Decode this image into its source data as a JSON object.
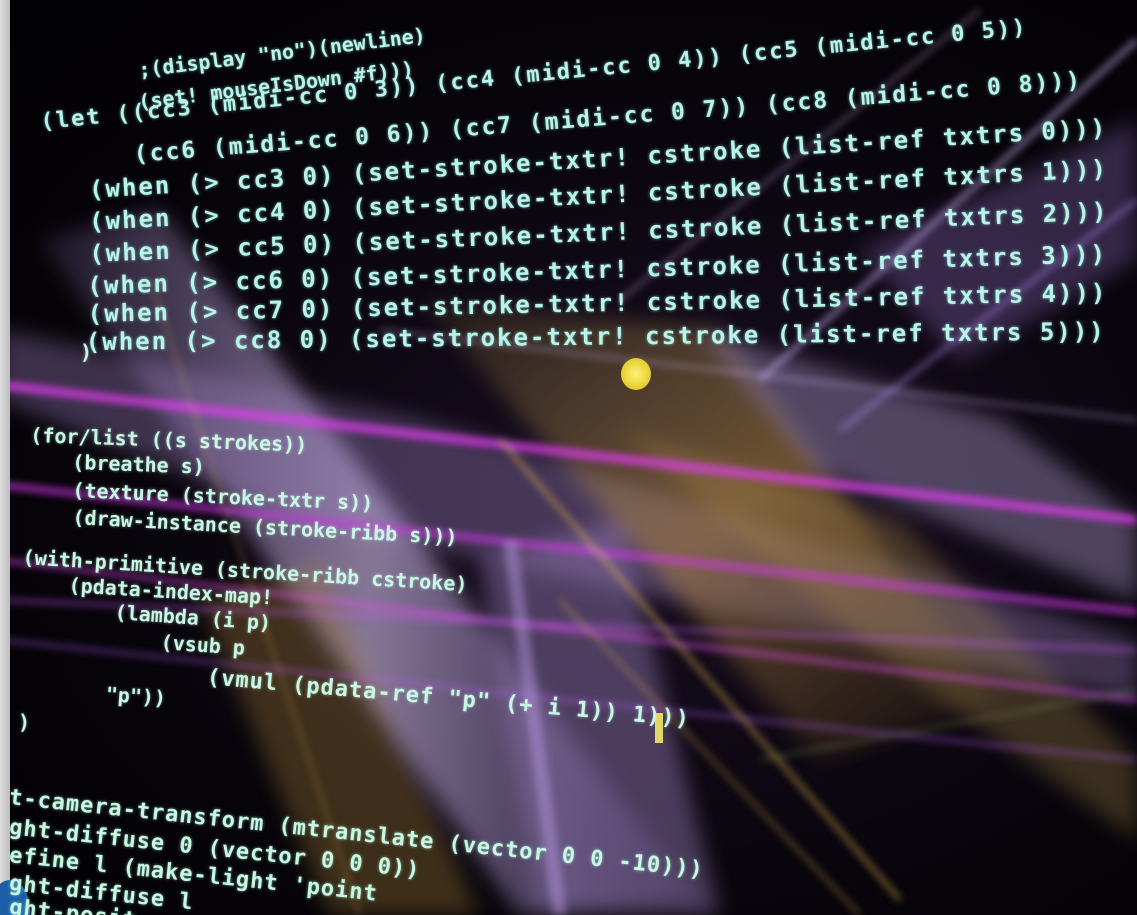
{
  "code": {
    "lines": [
      ";(display \"no\")(newline)",
      "(set! mouseIsDown #f)))",
      "(let ((cc3 (midi-cc 0 3)) (cc4 (midi-cc 0 4)) (cc5 (midi-cc 0 5))",
      "(cc6 (midi-cc 0 6)) (cc7 (midi-cc 0 7)) (cc8 (midi-cc 0 8)))",
      "(when (> cc3 0) (set-stroke-txtr! cstroke (list-ref txtrs 0)))",
      "(when (> cc4 0) (set-stroke-txtr! cstroke (list-ref txtrs 1)))",
      "(when (> cc5 0) (set-stroke-txtr! cstroke (list-ref txtrs 2)))",
      "(when (> cc6 0) (set-stroke-txtr! cstroke (list-ref txtrs 3)))",
      "(when (> cc7 0) (set-stroke-txtr! cstroke (list-ref txtrs 4)))",
      "(when (> cc8 0) (set-stroke-txtr! cstroke (list-ref txtrs 5)))",
      ")",
      "(for/list ((s strokes))",
      "(breathe s)",
      "(texture (stroke-txtr s))",
      "(draw-instance (stroke-ribb s)))",
      "(with-primitive (stroke-ribb cstroke)",
      "(pdata-index-map!",
      "(lambda (i p)",
      "(vsub p",
      "(vmul (pdata-ref \"p\" (+ i 1)) 1)))",
      "\"p\"))",
      ")",
      "t-camera-transform (mtranslate (vector 0 0 -10)))",
      "ght-diffuse 0 (vector 0 0 0))",
      "efine l (make-light 'point",
      "ght-diffuse l",
      "ght-posit"
    ]
  },
  "colors": {
    "code_text": "#b8f4ea",
    "background": "#050208",
    "streak_magenta": "#e23cf0",
    "streak_violet": "#b58cff",
    "streak_gold": "#e0b54a",
    "cursor": "#f2dc3a"
  }
}
